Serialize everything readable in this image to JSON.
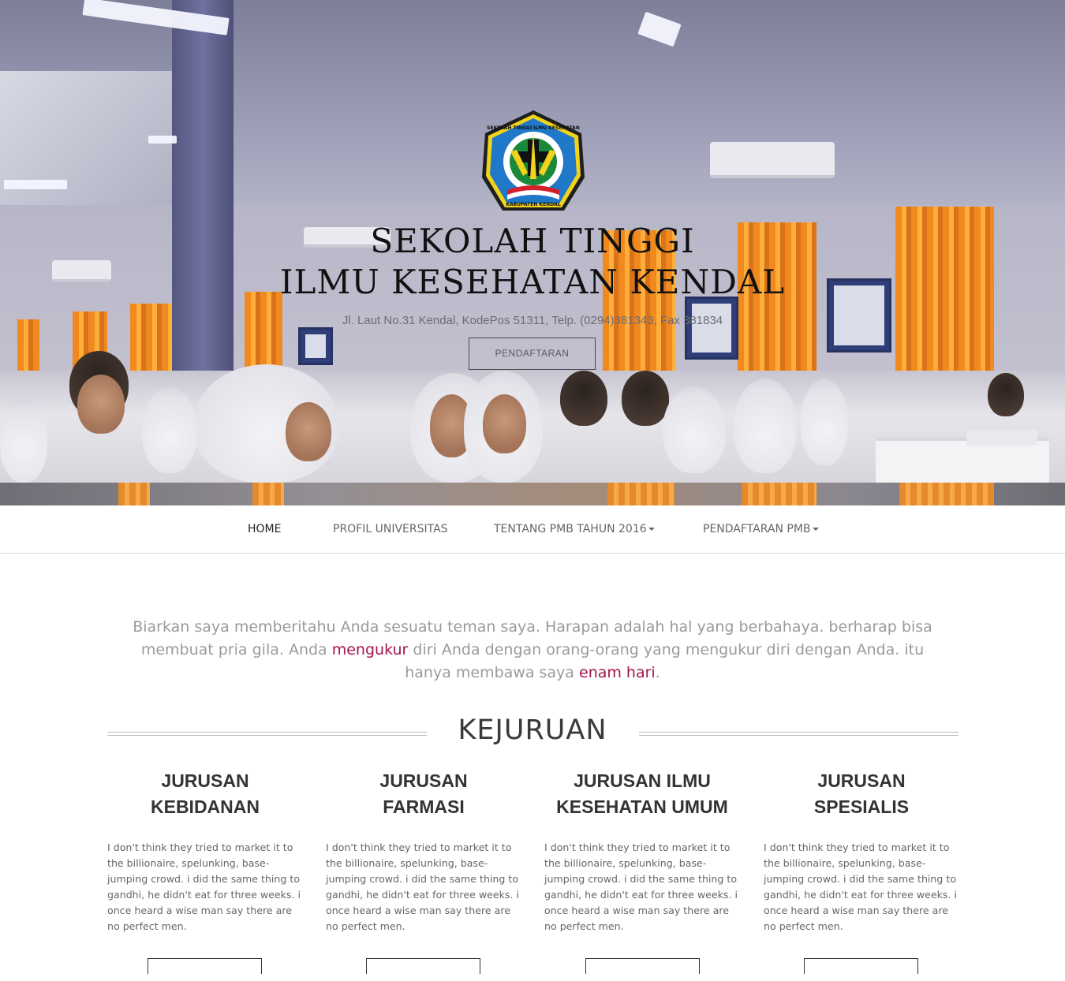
{
  "hero": {
    "logo_text_top": "SEKOLAH TINGGI ILMU KESEHATAN",
    "logo_text_bottom": "KABUPATEN KENDAL",
    "title_line1": "SEKOLAH TINGGI",
    "title_line2": "ILMU KESEHATAN KENDAL",
    "address": "Jl. Laut No.31 Kendal, KodePos 51311, Telp. (0294)381343, Fax 381834",
    "cta_label": "PENDAFTARAN"
  },
  "nav": {
    "items": [
      {
        "label": "HOME",
        "active": true,
        "dropdown": false
      },
      {
        "label": "PROFIL UNIVERSITAS",
        "active": false,
        "dropdown": false
      },
      {
        "label": "TENTANG PMB TAHUN 2016",
        "active": false,
        "dropdown": true
      },
      {
        "label": "PENDAFTARAN PMB",
        "active": false,
        "dropdown": true
      }
    ]
  },
  "intro": {
    "part1": "Biarkan saya memberitahu Anda sesuatu teman saya. Harapan adalah hal yang berbahaya. berharap bisa membuat pria gila. Anda ",
    "link1": "mengukur",
    "part2": " diri Anda dengan orang-orang yang mengukur diri dengan Anda. itu hanya membawa saya ",
    "link2": "enam hari",
    "part3": "."
  },
  "section": {
    "title": "KEJURUAN"
  },
  "departments": [
    {
      "title_line1": "JURUSAN",
      "title_line2": "KEBIDANAN",
      "text": "I don't think they tried to market it to the billionaire, spelunking, base-jumping crowd. i did the same thing to gandhi, he didn't eat for three weeks. i once heard a wise man say there are no perfect men."
    },
    {
      "title_line1": "JURUSAN",
      "title_line2": "FARMASI",
      "text": "I don't think they tried to market it to the billionaire, spelunking, base-jumping crowd. i did the same thing to gandhi, he didn't eat for three weeks. i once heard a wise man say there are no perfect men."
    },
    {
      "title_line1": "JURUSAN ILMU",
      "title_line2": "KESEHATAN UMUM",
      "text": "I don't think they tried to market it to the billionaire, spelunking, base-jumping crowd. i did the same thing to gandhi, he didn't eat for three weeks. i once heard a wise man say there are no perfect men."
    },
    {
      "title_line1": "JURUSAN",
      "title_line2": "SPESIALIS",
      "text": "I don't think they tried to market it to the billionaire, spelunking, base-jumping crowd. i did the same thing to gandhi, he didn't eat for three weeks. i once heard a wise man say there are no perfect men."
    }
  ],
  "colors": {
    "accent_link": "#a4134e",
    "logo_blue": "#1f78c8",
    "logo_yellow": "#f2d31b",
    "nav_text": "#666666"
  }
}
